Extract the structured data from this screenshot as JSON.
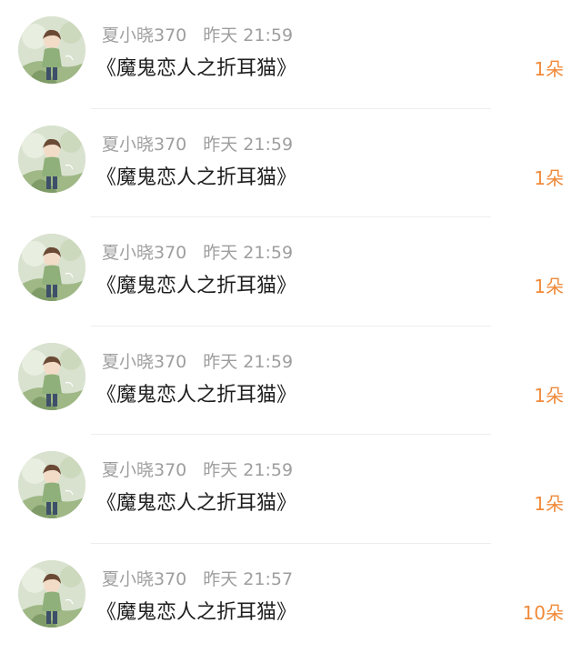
{
  "icons": {
    "avatar": "avatar-image"
  },
  "colors": {
    "meta_text": "#9e9e9e",
    "title_text": "#1f1f1f",
    "gift_text": "#f08a3a"
  },
  "items": [
    {
      "name": "夏小晓370",
      "time": "昨天 21:59",
      "title": "《魔鬼恋人之折耳猫》",
      "gift": "1朵"
    },
    {
      "name": "夏小晓370",
      "time": "昨天 21:59",
      "title": "《魔鬼恋人之折耳猫》",
      "gift": "1朵"
    },
    {
      "name": "夏小晓370",
      "time": "昨天 21:59",
      "title": "《魔鬼恋人之折耳猫》",
      "gift": "1朵"
    },
    {
      "name": "夏小晓370",
      "time": "昨天 21:59",
      "title": "《魔鬼恋人之折耳猫》",
      "gift": "1朵"
    },
    {
      "name": "夏小晓370",
      "time": "昨天 21:59",
      "title": "《魔鬼恋人之折耳猫》",
      "gift": "1朵"
    },
    {
      "name": "夏小晓370",
      "time": "昨天 21:57",
      "title": "《魔鬼恋人之折耳猫》",
      "gift": "10朵"
    }
  ]
}
